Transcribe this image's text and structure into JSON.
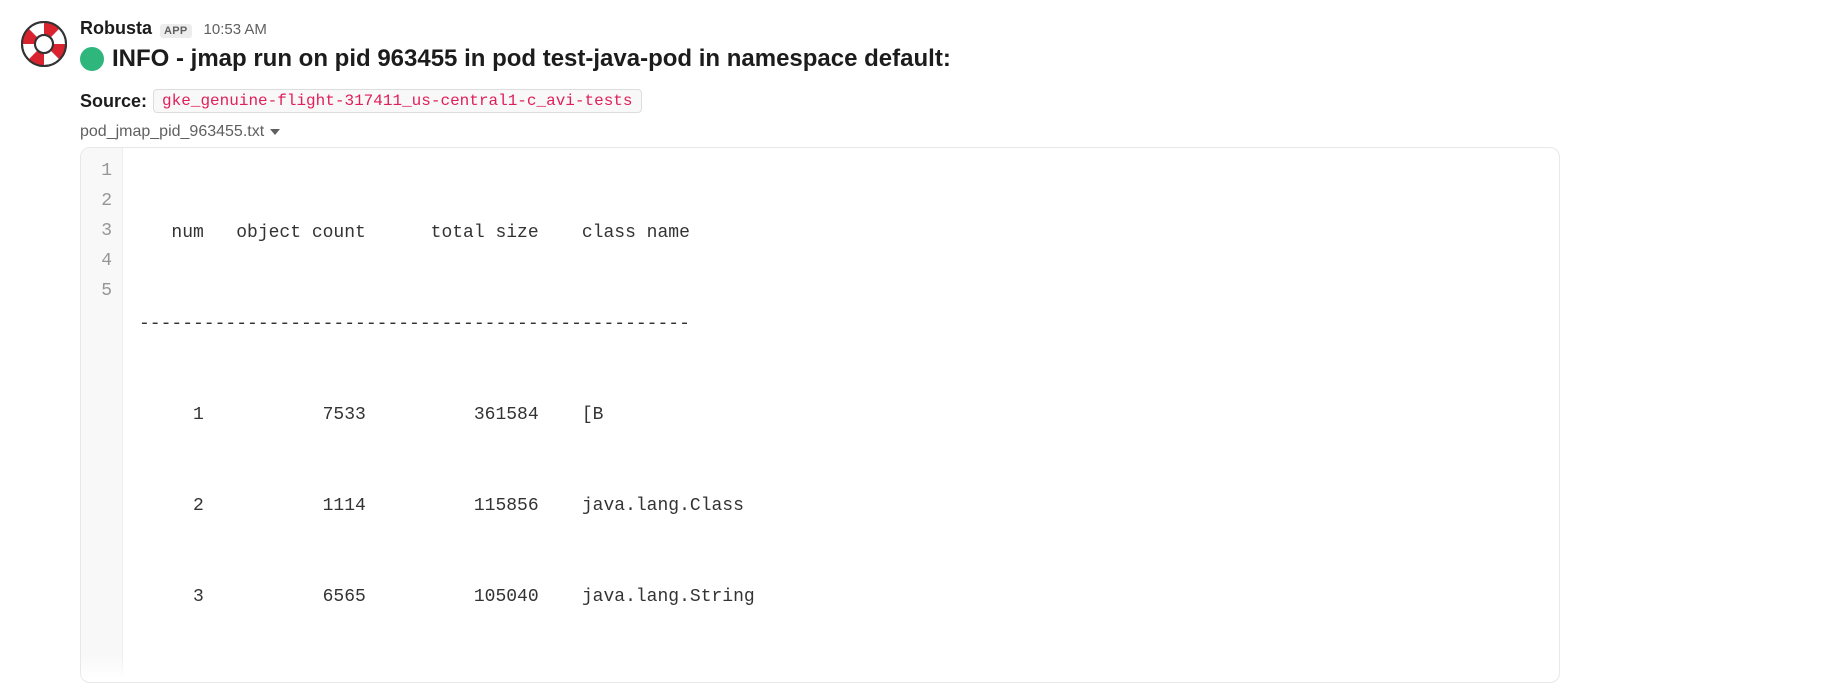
{
  "sender": {
    "name": "Robusta",
    "badge": "APP",
    "timestamp": "10:53 AM"
  },
  "status_color": "#2eb67d",
  "title": "INFO - jmap run on pid 963455 in pod test-java-pod in namespace default:",
  "source": {
    "label": "Source:",
    "value": "gke_genuine-flight-317411_us-central1-c_avi-tests"
  },
  "attachment": {
    "filename": "pod_jmap_pid_963455.txt",
    "lines": [
      "   num   object count      total size    class name",
      "---------------------------------------------------",
      "     1           7533          361584    [B",
      "     2           1114          115856    java.lang.Class",
      "     3           6565          105040    java.lang.String"
    ],
    "gutter": [
      "1",
      "2",
      "3",
      "4",
      "5"
    ]
  }
}
